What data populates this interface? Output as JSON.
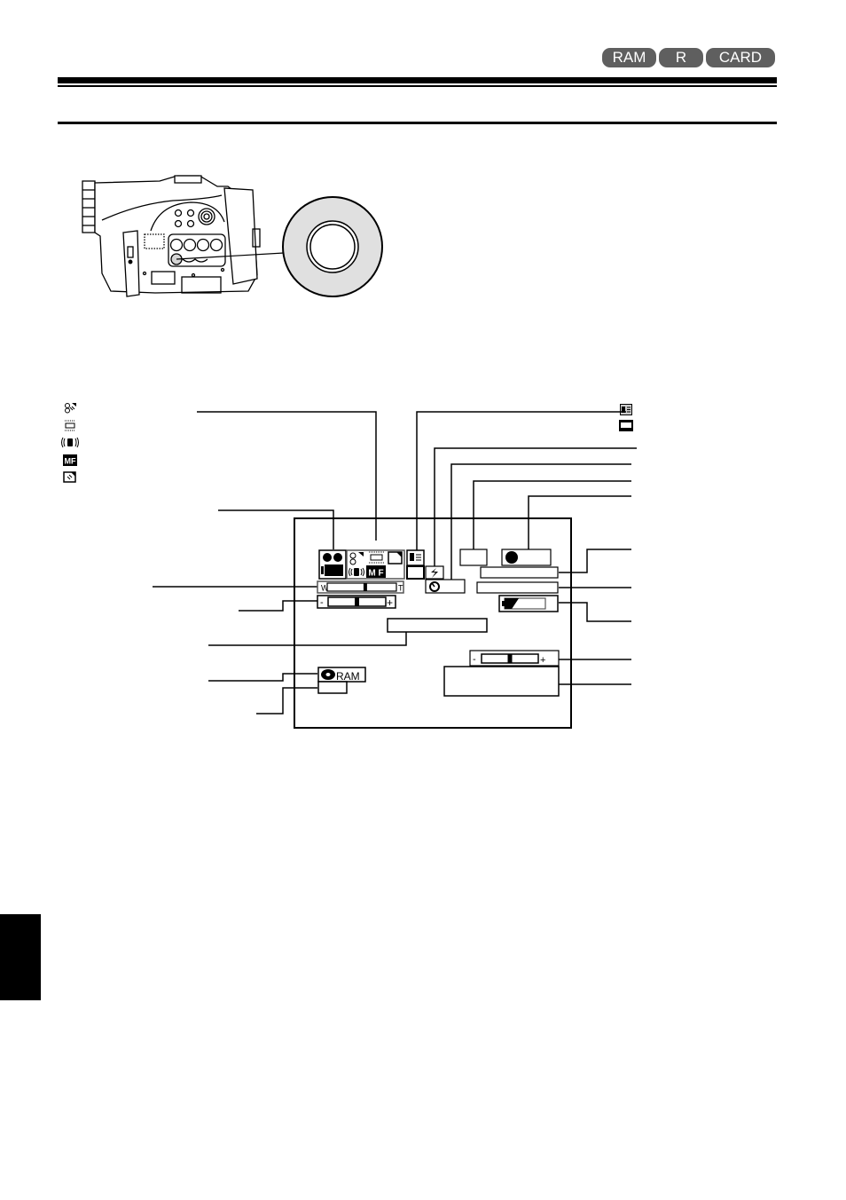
{
  "header": {
    "badges": [
      {
        "label": "RAM"
      },
      {
        "label": "R"
      },
      {
        "label": "CARD"
      }
    ],
    "badge_color": "#5f5f5f"
  },
  "illustration": {
    "subject": "camcorder-side-view",
    "callout": "magnified-button"
  },
  "legend_left": [
    {
      "icon": "backlight-spotlight-icon"
    },
    {
      "icon": "fluorescent-light-icon"
    },
    {
      "icon": "image-stabilizer-icon"
    },
    {
      "icon": "manual-focus-icon"
    },
    {
      "icon": "exposure-icon"
    }
  ],
  "legend_right": [
    {
      "icon": "wide-mode-icon"
    },
    {
      "icon": "16-9-screen-icon"
    }
  ],
  "osd": {
    "zoom_bar": {
      "wide_label": "W",
      "tele_label": "T",
      "level": 0.55
    },
    "exposure_bar": {
      "minus_label": "-",
      "plus_label": "+",
      "level": 0.5
    },
    "volume_bar": {
      "minus_label": "-",
      "plus_label": "+",
      "level": 0.5
    },
    "disc_label": "RAM",
    "mf_label": "M F",
    "battery_level": 0.35
  }
}
